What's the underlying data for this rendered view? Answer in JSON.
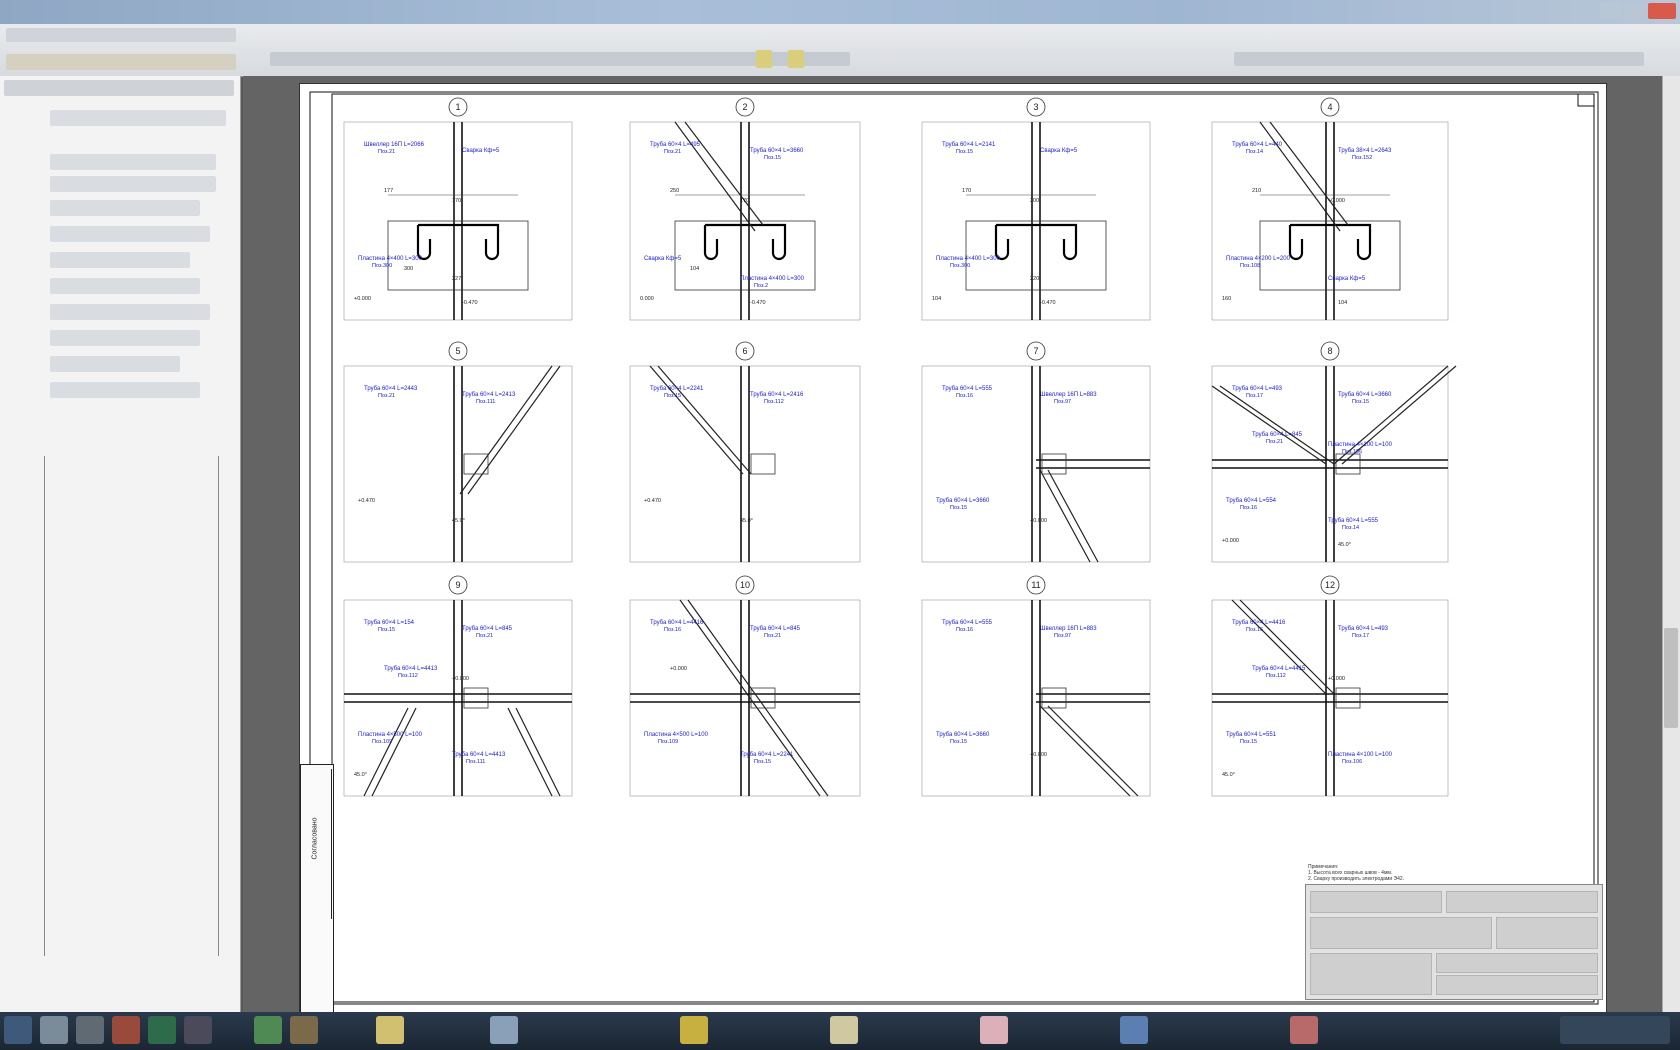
{
  "window": {
    "title_colors": {
      "bar": "#a9bfd9",
      "close": "#d95a4a"
    }
  },
  "sheet": {
    "details": [
      {
        "num": "1",
        "labels": [
          {
            "t": "Швеллер 16П L=2066",
            "s": "Поз.21"
          },
          {
            "t": "Сварка Кф=5",
            "s": ""
          },
          {
            "t": "Пластина 4×400 L=300",
            "s": "Поз.300"
          },
          {
            "t": "227",
            "s": ""
          },
          {
            "t": "177",
            "s": ""
          },
          {
            "t": "170",
            "s": ""
          },
          {
            "t": "+0.000",
            "s": ""
          },
          {
            "t": "-0.470",
            "s": ""
          },
          {
            "t": "300",
            "s": ""
          }
        ]
      },
      {
        "num": "2",
        "labels": [
          {
            "t": "Труба 60×4 L=495",
            "s": "Поз.21"
          },
          {
            "t": "Труба 60×4 L=3660",
            "s": "Поз.15"
          },
          {
            "t": "Сварка Кф=5",
            "s": ""
          },
          {
            "t": "Пластина 4×400 L=300",
            "s": "Поз.2"
          },
          {
            "t": "250",
            "s": ""
          },
          {
            "t": "170",
            "s": ""
          },
          {
            "t": "0.000",
            "s": ""
          },
          {
            "t": "-0.470",
            "s": ""
          },
          {
            "t": "104",
            "s": ""
          }
        ]
      },
      {
        "num": "3",
        "labels": [
          {
            "t": "Труба 60×4 L=2141",
            "s": "Поз.15"
          },
          {
            "t": "Сварка Кф=5",
            "s": ""
          },
          {
            "t": "Пластина 4×400 L=300",
            "s": "Поз.300"
          },
          {
            "t": "220",
            "s": ""
          },
          {
            "t": "170",
            "s": ""
          },
          {
            "t": "300",
            "s": ""
          },
          {
            "t": "104",
            "s": ""
          },
          {
            "t": "-0.470",
            "s": ""
          }
        ]
      },
      {
        "num": "4",
        "labels": [
          {
            "t": "Труба 60×4 L=440",
            "s": "Поз.14"
          },
          {
            "t": "Труба 38×4 L=2643",
            "s": "Поз.152"
          },
          {
            "t": "Пластина 4×200 L=200",
            "s": "Поз.108"
          },
          {
            "t": "Сварка Кф=5",
            "s": ""
          },
          {
            "t": "210",
            "s": ""
          },
          {
            "t": "+0.000",
            "s": ""
          },
          {
            "t": "160",
            "s": ""
          },
          {
            "t": "104",
            "s": ""
          }
        ]
      },
      {
        "num": "5",
        "labels": [
          {
            "t": "Труба 60×4 L=2443",
            "s": "Поз.21"
          },
          {
            "t": "Труба 60×4 L=2413",
            "s": "Поз.111"
          },
          {
            "t": "+0.470",
            "s": ""
          },
          {
            "t": "45.0°",
            "s": ""
          }
        ]
      },
      {
        "num": "6",
        "labels": [
          {
            "t": "Труба 60×4 L=2241",
            "s": "Поз.15"
          },
          {
            "t": "Труба 60×4 L=2416",
            "s": "Поз.112"
          },
          {
            "t": "+0.470",
            "s": ""
          },
          {
            "t": "45.0°",
            "s": ""
          }
        ]
      },
      {
        "num": "7",
        "labels": [
          {
            "t": "Труба 60×4 L=555",
            "s": "Поз.16"
          },
          {
            "t": "Швеллер 16П L=883",
            "s": "Поз.97"
          },
          {
            "t": "Труба 60×4 L=3660",
            "s": "Поз.15"
          },
          {
            "t": "+0.000",
            "s": ""
          }
        ]
      },
      {
        "num": "8",
        "labels": [
          {
            "t": "Труба 60×4 L=493",
            "s": "Поз.17"
          },
          {
            "t": "Труба 60×4 L=3660",
            "s": "Поз.15"
          },
          {
            "t": "Труба 60×4 L=554",
            "s": "Поз.16"
          },
          {
            "t": "Труба 60×4 L=555",
            "s": "Поз.14"
          },
          {
            "t": "Труба 60×4 L=845",
            "s": "Поз.21"
          },
          {
            "t": "Пластина 4×100 L=100",
            "s": "Поз.106"
          },
          {
            "t": "+0.000",
            "s": ""
          },
          {
            "t": "45.0°",
            "s": ""
          }
        ]
      },
      {
        "num": "9",
        "labels": [
          {
            "t": "Труба 60×4 L=154",
            "s": "Поз.15"
          },
          {
            "t": "Труба 60×4 L=845",
            "s": "Поз.21"
          },
          {
            "t": "Пластина 4×500 L=100",
            "s": "Поз.109"
          },
          {
            "t": "Труба 60×4 L=4413",
            "s": "Поз.111"
          },
          {
            "t": "Труба 60×4 L=4413",
            "s": "Поз.112"
          },
          {
            "t": "+0.000",
            "s": ""
          },
          {
            "t": "45.0°",
            "s": ""
          }
        ]
      },
      {
        "num": "10",
        "labels": [
          {
            "t": "Труба 60×4 L=4416",
            "s": "Поз.16"
          },
          {
            "t": "Труба 60×4 L=845",
            "s": "Поз.21"
          },
          {
            "t": "Пластина 4×500 L=100",
            "s": "Поз.109"
          },
          {
            "t": "Труба 60×4 L=2241",
            "s": "Поз.15"
          },
          {
            "t": "+0.000",
            "s": ""
          }
        ]
      },
      {
        "num": "11",
        "labels": [
          {
            "t": "Труба 60×4 L=555",
            "s": "Поз.16"
          },
          {
            "t": "Швеллер 16П L=883",
            "s": "Поз.97"
          },
          {
            "t": "Труба 60×4 L=3660",
            "s": "Поз.15"
          },
          {
            "t": "+0.000",
            "s": ""
          }
        ]
      },
      {
        "num": "12",
        "labels": [
          {
            "t": "Труба 60×4 L=4416",
            "s": "Поз.16"
          },
          {
            "t": "Труба 60×4 L=493",
            "s": "Поз.17"
          },
          {
            "t": "Труба 60×4 L=551",
            "s": "Поз.15"
          },
          {
            "t": "Пластина 4×100 L=100",
            "s": "Поз.106"
          },
          {
            "t": "Труба 60×4 L=4415",
            "s": "Поз.112"
          },
          {
            "t": "+0.000",
            "s": ""
          },
          {
            "t": "45.0°",
            "s": ""
          }
        ]
      }
    ],
    "notes": {
      "title": "Примечания:",
      "line1": "1. Высота всех сварных швов - 4мм.",
      "line2": "2. Сварку производить электродами Э42."
    },
    "stamp_label": "Согласовано"
  }
}
